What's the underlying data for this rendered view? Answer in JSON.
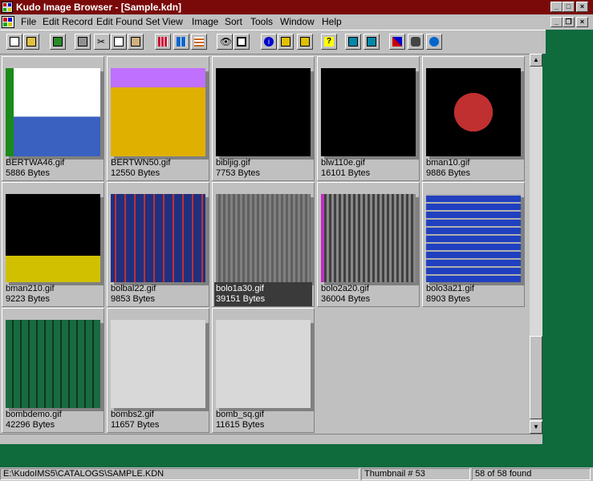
{
  "window": {
    "title": "Kudo Image Browser - [Sample.kdn]"
  },
  "menu": [
    "File",
    "Edit Record",
    "Edit Found Set",
    "View",
    "Image",
    "Sort",
    "Tools",
    "Window",
    "Help"
  ],
  "menu_underline": [
    "F",
    "E",
    "F",
    "V",
    "I",
    "S",
    "T",
    "W",
    "H"
  ],
  "toolbar_icons": [
    "new-document-icon",
    "open-folder-icon",
    "catalog-icon",
    "print-icon",
    "cut-icon",
    "copy-icon",
    "paste-icon",
    "grid-small-icon",
    "grid-medium-icon",
    "grid-list-icon",
    "view-eye-icon",
    "slideshow-icon",
    "info-icon",
    "find-icon",
    "find-next-icon",
    "help-icon",
    "select-all-icon",
    "invert-selection-icon",
    "tools-icon",
    "network-icon",
    "globe-icon"
  ],
  "thumbnails": [
    {
      "name": "BERTWA46.gif",
      "size": "5886 Bytes"
    },
    {
      "name": "BERTWN50.gif",
      "size": "12550 Bytes"
    },
    {
      "name": "bibljig.gif",
      "size": "7753 Bytes"
    },
    {
      "name": "blw110e.gif",
      "size": "16101 Bytes"
    },
    {
      "name": "bman10.gif",
      "size": "9886 Bytes"
    },
    {
      "name": "bman210.gif",
      "size": "9223 Bytes"
    },
    {
      "name": "bolbal22.gif",
      "size": "9853 Bytes"
    },
    {
      "name": "bolo1a30.gif",
      "size": "39151 Bytes",
      "selected": true
    },
    {
      "name": "bolo2a20.gif",
      "size": "36004 Bytes"
    },
    {
      "name": "bolo3a21.gif",
      "size": "8903 Bytes"
    },
    {
      "name": "bombdemo.gif",
      "size": "42296 Bytes"
    },
    {
      "name": "bombs2.gif",
      "size": "11657 Bytes"
    },
    {
      "name": "bomb_sq.gif",
      "size": "11615 Bytes"
    }
  ],
  "status": {
    "path": "E:\\KudoIMS5\\CATALOGS\\SAMPLE.KDN",
    "thumbnail": "Thumbnail # 53",
    "found": "58 of 58 found"
  }
}
